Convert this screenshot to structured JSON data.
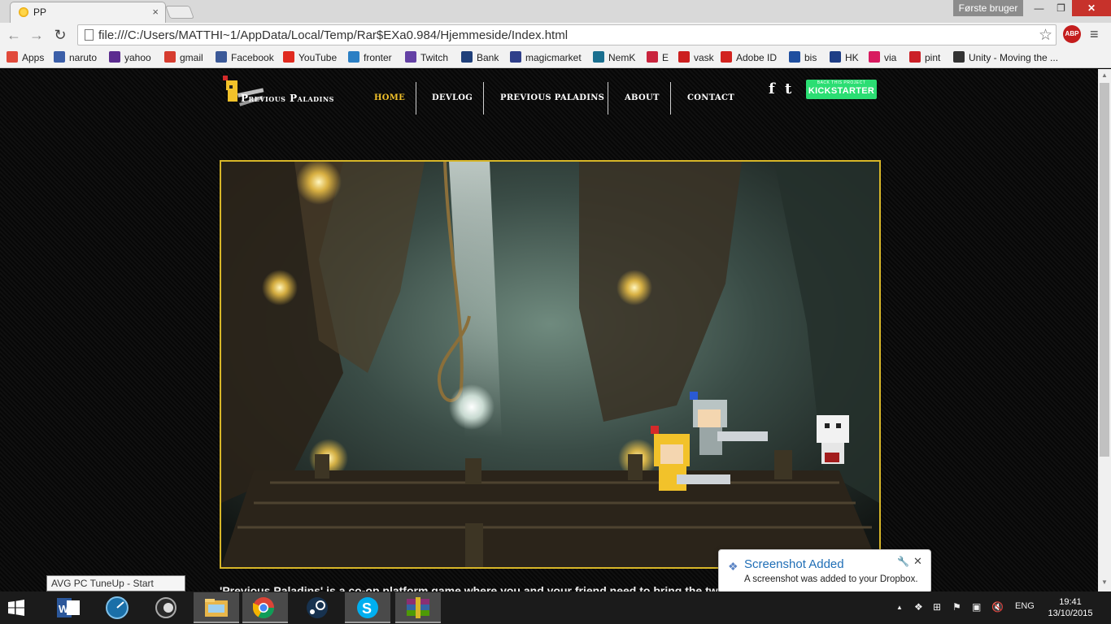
{
  "window": {
    "tab_title": "PP",
    "tab_close": "×",
    "profile": "Første bruger",
    "minimize": "—",
    "restore": "❐",
    "close": "✕"
  },
  "toolbar": {
    "back": "←",
    "forward": "→",
    "reload": "↻",
    "url": "file:///C:/Users/MATTHI~1/AppData/Local/Temp/Rar$EXa0.984/Hjemmeside/Index.html",
    "star": "☆",
    "abp": "ABP",
    "menu": "≡"
  },
  "bookmarks": [
    {
      "label": "Apps",
      "color": "#e14a3b"
    },
    {
      "label": "naruto",
      "color": "#3b5ea8"
    },
    {
      "label": "yahoo",
      "color": "#5b2c8f"
    },
    {
      "label": "gmail",
      "color": "#d63c2f"
    },
    {
      "label": "Facebook",
      "color": "#3b5998"
    },
    {
      "label": "YouTube",
      "color": "#e02a1f"
    },
    {
      "label": "fronter",
      "color": "#2b7fc4"
    },
    {
      "label": "Twitch",
      "color": "#6441a5"
    },
    {
      "label": "Bank",
      "color": "#1f3f7a"
    },
    {
      "label": "magicmarket",
      "color": "#2f3f8a"
    },
    {
      "label": "NemK",
      "color": "#1a6f8f"
    },
    {
      "label": "E",
      "color": "#c9243d"
    },
    {
      "label": "vask",
      "color": "#cc1f1f"
    },
    {
      "label": "Adobe ID",
      "color": "#d2231f"
    },
    {
      "label": "bis",
      "color": "#1f4f9f"
    },
    {
      "label": "HK",
      "color": "#1e3e86"
    },
    {
      "label": "via",
      "color": "#d81b60"
    },
    {
      "label": "pint",
      "color": "#cb2027"
    },
    {
      "label": "Unity - Moving the ...",
      "color": "#333333"
    }
  ],
  "site": {
    "logo_text": "Previous Paladins",
    "nav": [
      {
        "label": "HOME"
      },
      {
        "label": "DEVLOG"
      },
      {
        "label": "PREVIOUS PALADINS"
      },
      {
        "label": "ABOUT"
      },
      {
        "label": "CONTACT"
      }
    ],
    "facebook": "f",
    "twitter": "t",
    "kickstarter_small": "BACK THIS PROJECT",
    "kickstarter_big": "KICKSTARTER",
    "intro": "'Previous Paladins' is a co-op platform game where you and your friend need to bring the two"
  },
  "tooltip": "AVG PC TuneUp - Start Center",
  "notification": {
    "title": "Screenshot Added",
    "body": "A screenshot was added to your Dropbox.",
    "icon": "❖",
    "wrench": "🔧",
    "close": "✕"
  },
  "taskbar": {
    "tray_arrow": "▲",
    "language": "ENG",
    "time": "19:41",
    "date": "13/10/2015"
  },
  "colors": {
    "accent_gold": "#f2c22a",
    "frame_gold": "#d7b628",
    "kickstarter": "#2bde73",
    "notification_title": "#1f6eb6"
  }
}
